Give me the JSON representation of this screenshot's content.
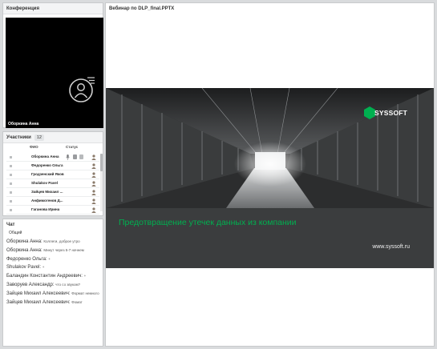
{
  "conference": {
    "title": "Конференция",
    "speaker_name": "Оборкина Анна"
  },
  "participants": {
    "title": "Участники",
    "count": "12",
    "col_name": "ФИО",
    "col_status": "Статус",
    "rows": [
      {
        "name": "Оборкина Анна"
      },
      {
        "name": "Федоренко Ольга"
      },
      {
        "name": "Гродзенский Яков"
      },
      {
        "name": "Shulakov Pavel"
      },
      {
        "name": "Зайцев Михаил ..."
      },
      {
        "name": "Анфимогенов Д..."
      },
      {
        "name": "Гаганова Ирина"
      }
    ]
  },
  "chat": {
    "title": "Чат",
    "tab": "Общий",
    "messages": [
      {
        "author": "Оборкина Анна:",
        "text": "Коллеги, доброе утро"
      },
      {
        "author": "Оборкина Анна:",
        "text": "Минут через 5-7 начнем"
      },
      {
        "author": "Федоренко Ольга:",
        "text": "+"
      },
      {
        "author": "Shulakov Pavel:",
        "text": "+"
      },
      {
        "author": "Баландин Константин Андреевич:",
        "text": "+"
      },
      {
        "author": "Заворуев Александр:",
        "text": "что со звуком?"
      },
      {
        "author": "Зайцев Михаил Алексеевич:",
        "text": "Формат немного"
      },
      {
        "author": "Зайцев Михаил Алексеевич:",
        "text": "Фомат"
      }
    ]
  },
  "webinar": {
    "title": "Вебинар по DLP_final.PPTX",
    "slide": {
      "logo_text": "SYSSOFT",
      "heading": "Предотвращение утечек данных из компании",
      "url": "www.syssoft.ru"
    }
  },
  "colors": {
    "accent_green": "#00b050",
    "slide_dark": "#3b3d3e"
  }
}
